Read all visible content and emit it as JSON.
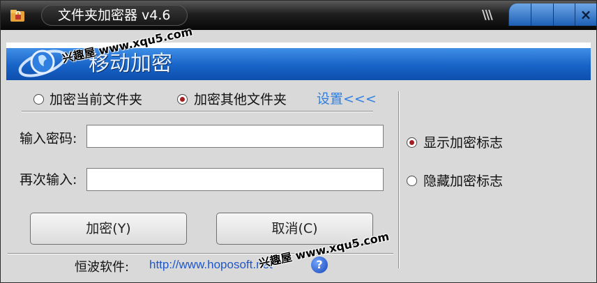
{
  "window": {
    "title": "文件夹加密器 v4.6",
    "title_stripes": "\\\\\\",
    "close_glyph": "×"
  },
  "banner": {
    "title": "移动加密"
  },
  "watermarks": [
    "兴趣屋 www.xqu5.com",
    "兴趣屋 www.xqu5.com"
  ],
  "mode": {
    "options": [
      {
        "label": "加密当前文件夹",
        "selected": false
      },
      {
        "label": "加密其他文件夹",
        "selected": true
      }
    ],
    "settings_link": "设置<<<"
  },
  "form": {
    "password_label": "输入密码:",
    "password_value": "",
    "confirm_label": "再次输入:",
    "confirm_value": ""
  },
  "buttons": {
    "encrypt": "加密(Y)",
    "cancel": "取消(C)"
  },
  "footer": {
    "label": "恒波软件:",
    "link": "http://www.hoposoft.net",
    "help_glyph": "?"
  },
  "marker": {
    "options": [
      {
        "label": "显示加密标志",
        "selected": true
      },
      {
        "label": "隐藏加密标志",
        "selected": false
      }
    ]
  },
  "colors": {
    "title_bar": "#1f1f1f",
    "banner_blue": "#1863c7",
    "link_blue": "#2f7fe0",
    "radio_dot": "#a32020",
    "body_bg": "#d9d9d9"
  }
}
